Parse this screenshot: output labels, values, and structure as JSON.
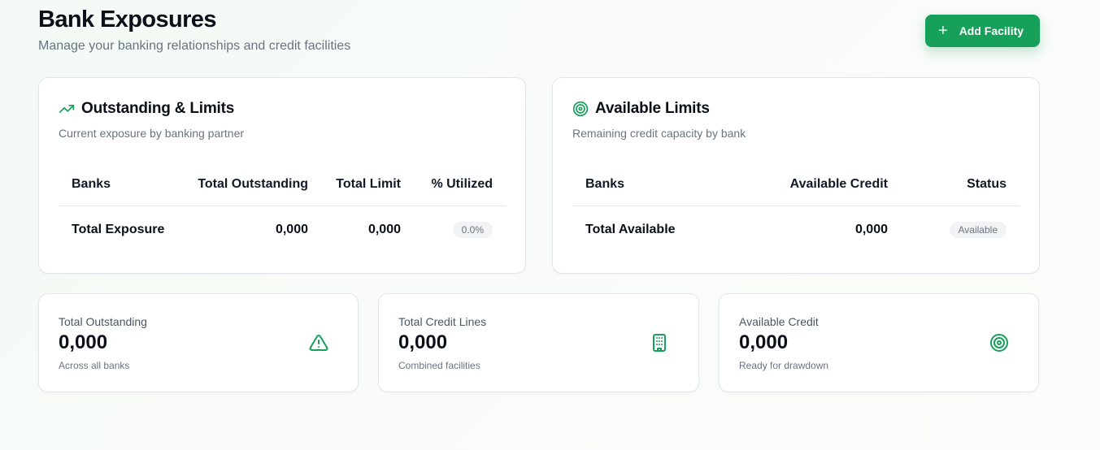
{
  "header": {
    "title": "Bank Exposures",
    "subtitle": "Manage your banking relationships and credit facilities",
    "add_button": "Add Facility",
    "add_icon": "plus-icon"
  },
  "accent": "#16a05a",
  "outstanding_card": {
    "icon": "trending-up-icon",
    "title": "Outstanding & Limits",
    "description": "Current exposure by banking partner",
    "columns": [
      "Banks",
      "Total Outstanding",
      "Total Limit",
      "% Utilized"
    ],
    "total_row": {
      "label": "Total Exposure",
      "outstanding": "0,000",
      "limit": "0,000",
      "utilized": "0.0%"
    }
  },
  "available_card": {
    "icon": "target-icon",
    "title": "Available Limits",
    "description": "Remaining credit capacity by bank",
    "columns": [
      "Banks",
      "Available Credit",
      "Status"
    ],
    "total_row": {
      "label": "Total Available",
      "available": "0,000",
      "status": "Available"
    }
  },
  "stats": [
    {
      "label": "Total Outstanding",
      "value": "0,000",
      "note": "Across all banks",
      "icon": "alert-triangle-icon"
    },
    {
      "label": "Total Credit Lines",
      "value": "0,000",
      "note": "Combined facilities",
      "icon": "building-icon"
    },
    {
      "label": "Available Credit",
      "value": "0,000",
      "note": "Ready for drawdown",
      "icon": "target-icon"
    }
  ]
}
